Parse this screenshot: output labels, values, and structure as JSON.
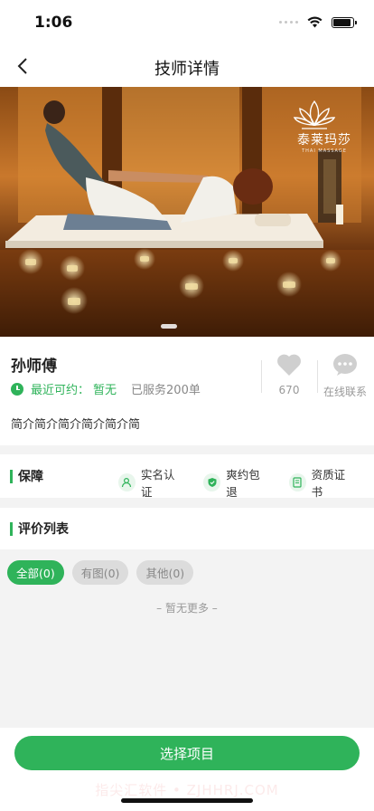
{
  "status_bar": {
    "time": "1:06",
    "battery_level": 0.9
  },
  "nav": {
    "title": "技师详情",
    "back_icon": "chevron-left-icon"
  },
  "hero": {
    "brand_name": "泰莱玛莎",
    "brand_sub": "THAI MASSAGE",
    "carousel_position": 1
  },
  "profile": {
    "name": "孙师傅",
    "appoint_label": "最近可约：",
    "appoint_value": "暂无",
    "served": "已服务200单",
    "intro": "简介简介简介简介简介简",
    "likes": "670",
    "contact_label": "在线联系"
  },
  "guarantee": {
    "title": "保障",
    "items": [
      {
        "label": "实名认证",
        "icon": "user-verify-icon"
      },
      {
        "label": "爽约包退",
        "icon": "shield-icon"
      },
      {
        "label": "资质证书",
        "icon": "certificate-icon"
      }
    ]
  },
  "reviews": {
    "title": "评价列表",
    "filters": [
      {
        "label": "全部(0)",
        "active": true
      },
      {
        "label": "有图(0)",
        "active": false
      },
      {
        "label": "其他(0)",
        "active": false
      }
    ],
    "empty_text": "– 暂无更多 –"
  },
  "bottom": {
    "select_label": "选择项目",
    "watermark": "指尖汇软件 • ZJHHRJ.COM"
  },
  "colors": {
    "accent": "#2fb35a",
    "chip_bg": "#dcdcdc",
    "page_bg": "#f3f3f3"
  }
}
